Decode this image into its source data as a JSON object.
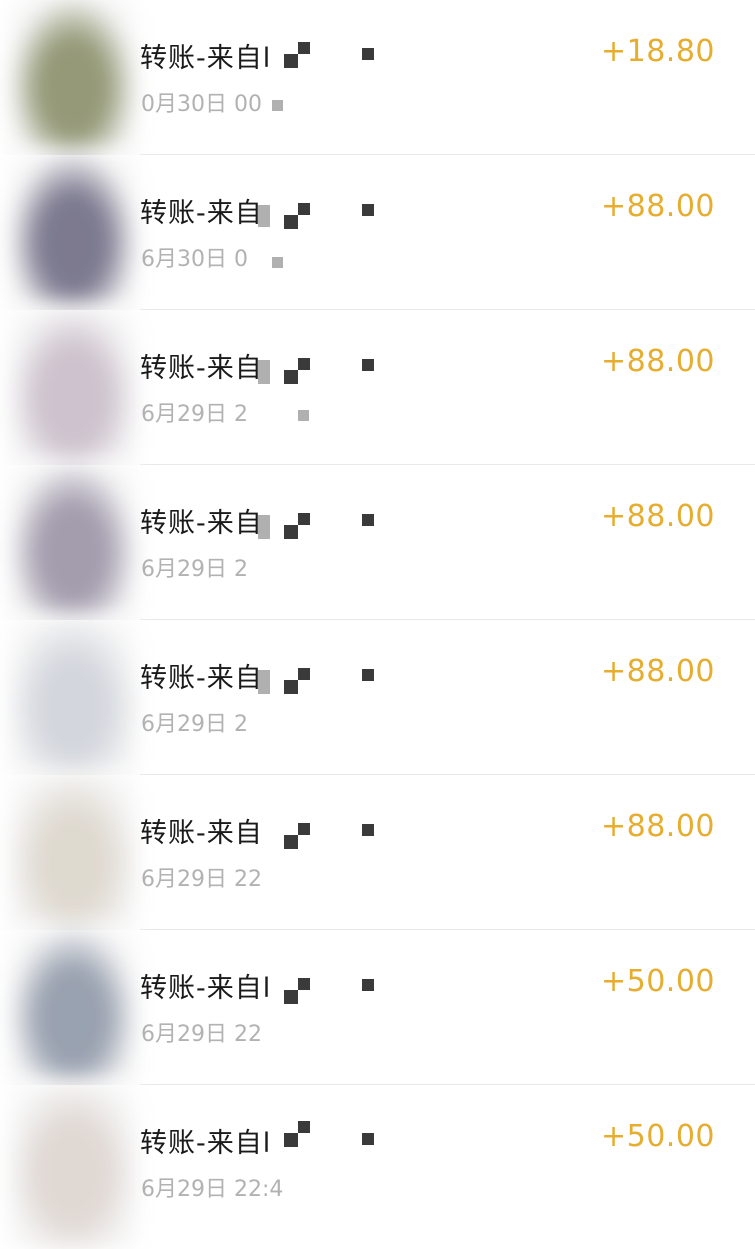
{
  "transactions": [
    {
      "title": "转账-来自l",
      "time": "0月30日 00",
      "amount": "+18.80",
      "avatar_color": "#8a8f6a"
    },
    {
      "title": "转账-来自",
      "time": "6月30日 0",
      "amount": "+88.00",
      "avatar_color": "#6f6c84"
    },
    {
      "title": "转账-来自",
      "time": "6月29日 2",
      "amount": "+88.00",
      "avatar_color": "#c8bcc8"
    },
    {
      "title": "转账-来自",
      "time": "6月29日 2",
      "amount": "+88.00",
      "avatar_color": "#9a93a6"
    },
    {
      "title": "转账-来自",
      "time": "6月29日 2",
      "amount": "+88.00",
      "avatar_color": "#cfd3da"
    },
    {
      "title": "转账-来自",
      "time": "6月29日 22",
      "amount": "+88.00",
      "avatar_color": "#dcd6cc"
    },
    {
      "title": "转账-来自l",
      "time": "6月29日 22",
      "amount": "+50.00",
      "avatar_color": "#8f98a8"
    },
    {
      "title": "转账-来自l",
      "time": "6月29日 22:4",
      "amount": "+50.00",
      "avatar_color": "#ddd4cf"
    }
  ],
  "colors": {
    "amount": "#e6ad2e",
    "title": "#1a1a1a",
    "time": "#b2b2b2",
    "divider": "#e8e8e8"
  }
}
